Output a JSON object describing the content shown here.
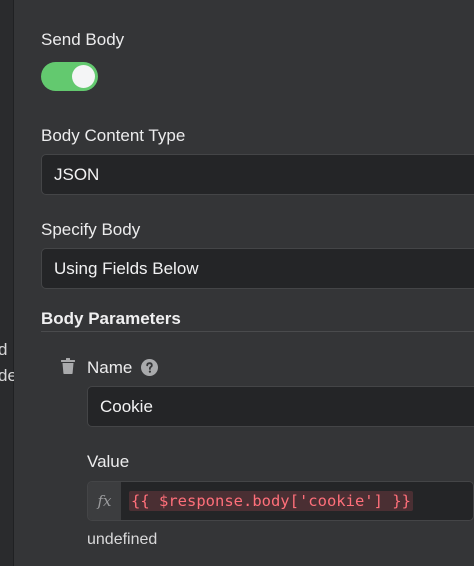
{
  "sidebar": {
    "clipped_lines": [
      "d",
      "de"
    ]
  },
  "send_body": {
    "label": "Send Body",
    "enabled": true,
    "toggle_color": "#63c96f"
  },
  "body_content_type": {
    "label": "Body Content Type",
    "value": "JSON"
  },
  "specify_body": {
    "label": "Specify Body",
    "value": "Using Fields Below"
  },
  "body_parameters": {
    "title": "Body Parameters",
    "items": [
      {
        "name_label": "Name",
        "name_value": "Cookie",
        "value_label": "Value",
        "fx_label": "fx",
        "expression": "{{ $response.body['cookie'] }}",
        "result": "undefined"
      }
    ]
  },
  "icons": {
    "delete": "trash-icon",
    "help": "question-circle-icon"
  }
}
